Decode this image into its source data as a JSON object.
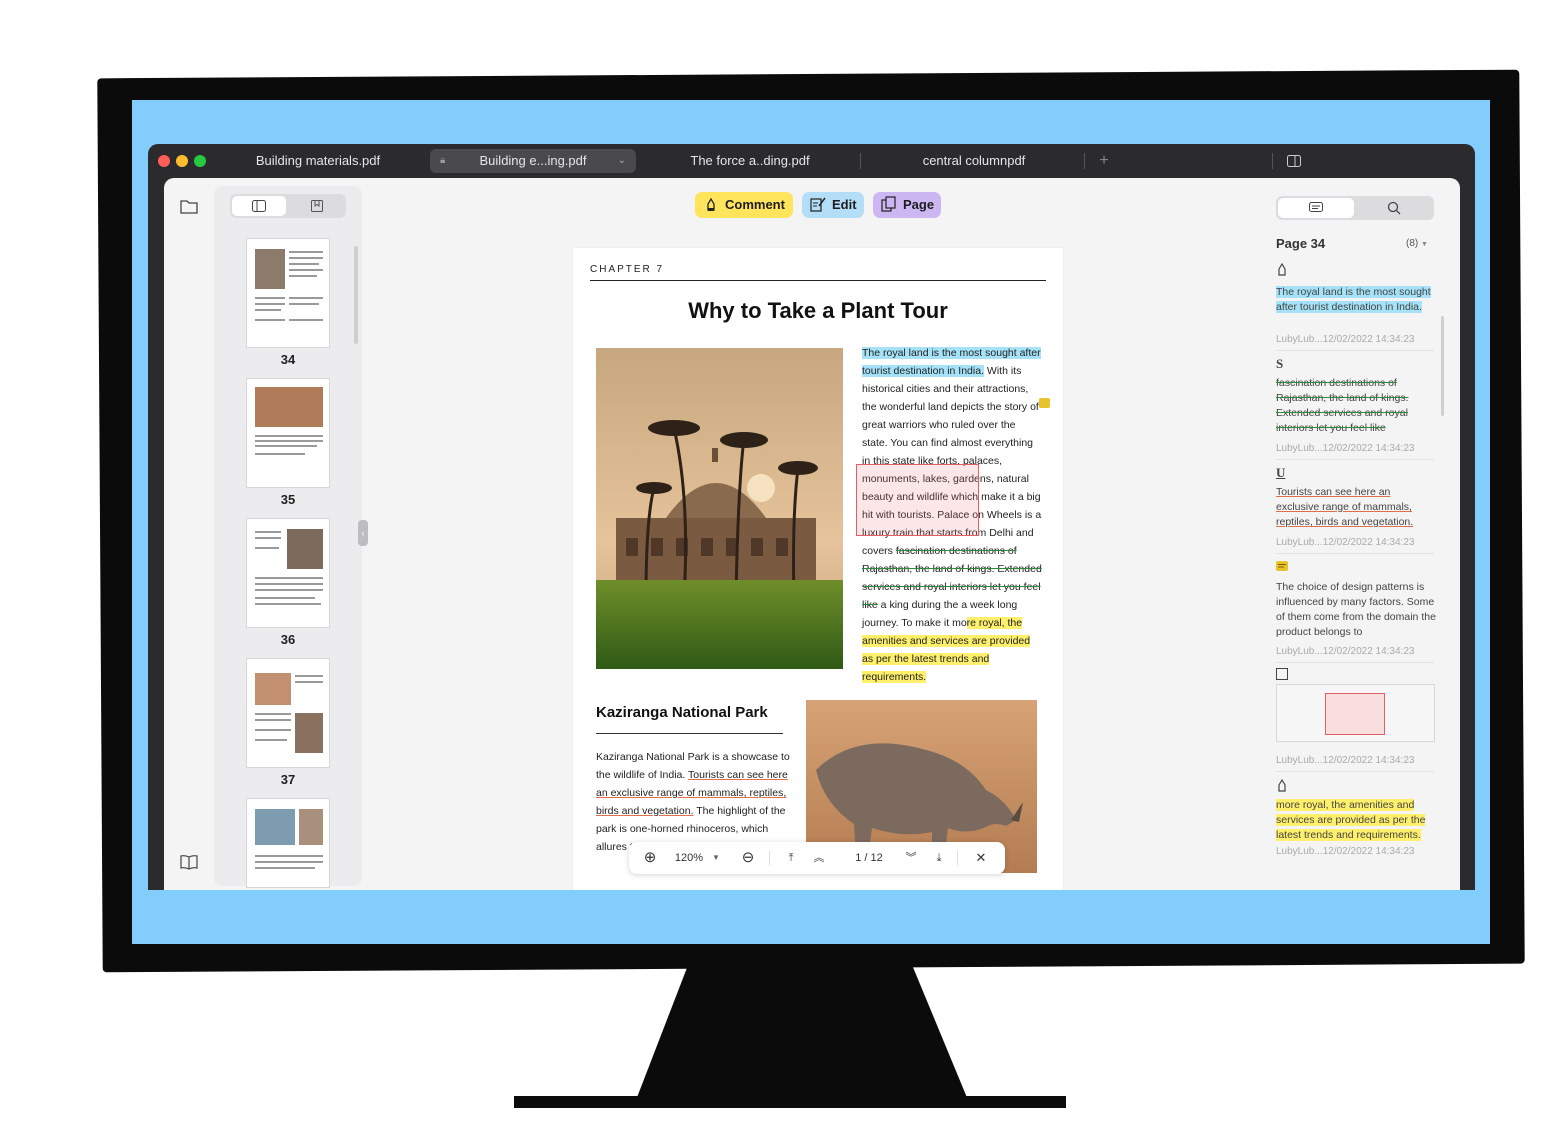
{
  "window": {
    "tabs": [
      {
        "label": "Building materials.pdf"
      },
      {
        "label": "Building e...ing.pdf",
        "active": true
      },
      {
        "label": "The force a..ding.pdf"
      },
      {
        "label": "central columnpdf"
      }
    ],
    "new_tab": "+"
  },
  "toolbar": {
    "comment": "Comment",
    "edit": "Edit",
    "page": "Page",
    "colors": {
      "comment": "#ffe45c",
      "edit": "#b4def8",
      "page": "#cdb7f2"
    }
  },
  "thumbnails": {
    "pages": [
      "34",
      "35",
      "36",
      "37"
    ]
  },
  "document": {
    "chapter": "CHAPTER 7",
    "title": "Why to Take a Plant Tour",
    "para1": {
      "hl_blue": "The royal land is the most sought after tourist destination in India.",
      "plain1": " With its historical cities and their attractions, the wonderful land depicts the story of great warriors who ruled over the state. You can find almost everything in this state like forts, palaces, monuments, lakes, gardens, natural beauty and wildlife which make it a big hit with tourists. Palace on Wheels is a luxury train that starts from Delhi and covers ",
      "strike": "fascination destinations of Rajasthan, the land of kings. Extended services and royal interiors let you feel like",
      "plain2": " a king during the a week long journey. To make it mo",
      "hl_yellow": "re royal, the amenities and services are provided as per the latest trends and requirements."
    },
    "section2_title": "Kaziranga National Park",
    "para2": {
      "plain1": "Kaziranga National Park is a showcase to the wildlife of India. ",
      "underline": "Tourists can see here an exclusive range of mammals, reptiles, birds and vegetation.",
      "plain2": " The highlight of the park is one-horned rhinoceros, which allures t... across"
    }
  },
  "zoombar": {
    "zoom": "120%",
    "page_indicator": "1 / 12"
  },
  "annotations_panel": {
    "page_label": "Page 34",
    "count": "(8)",
    "items": [
      {
        "icon": "highlight-icon",
        "text": "The royal land is the most sought after tourist destination in India.",
        "meta": "LubyLub...12/02/2022 14:34:23"
      },
      {
        "icon": "S",
        "text": "fascination destinations of Rajasthan, the land of kings. Extended services and royal interiors let you feel like",
        "meta": "LubyLub...12/02/2022 14:34:23"
      },
      {
        "icon": "U",
        "text": "Tourists can see here an exclusive range of mammals, reptiles, birds and vegetation.",
        "meta": "LubyLub...12/02/2022 14:34:23"
      },
      {
        "icon": "note-icon",
        "text": "The choice of design patterns is influenced by many factors. Some of them come from the domain the product belongs to",
        "meta": "LubyLub...12/02/2022 14:34:23"
      },
      {
        "icon": "rectangle-icon",
        "text": "",
        "meta": "LubyLub...12/02/2022 14:34:23"
      },
      {
        "icon": "highlight-icon",
        "text": "more royal, the amenities and services are provided as per the latest trends and requirements.",
        "meta": "LubyLub...12/02/2022 14:34:23"
      }
    ]
  }
}
